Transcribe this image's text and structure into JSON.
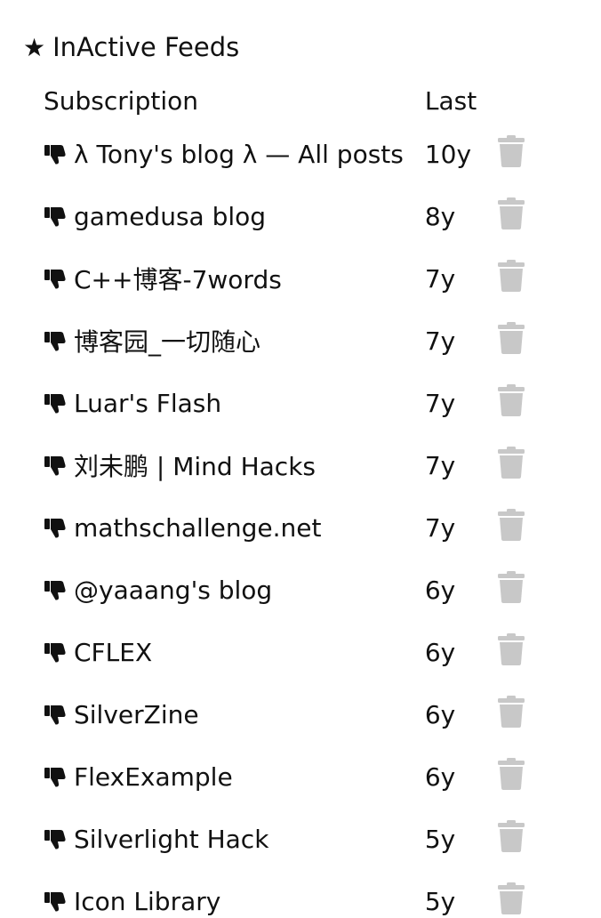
{
  "section": {
    "star": "★",
    "title": "InActive Feeds"
  },
  "columns": {
    "subscription": "Subscription",
    "last": "Last"
  },
  "icons": {
    "row_icon": "thumbs-down-icon",
    "delete_icon": "trash-icon",
    "trash_color": "#c8c8c8"
  },
  "feeds": [
    {
      "name": "λ Tony's blog λ — All posts",
      "last": "10y"
    },
    {
      "name": "gamedusa blog",
      "last": "8y"
    },
    {
      "name": "C++博客-7words",
      "last": "7y"
    },
    {
      "name": "博客园_一切随心",
      "last": "7y"
    },
    {
      "name": "Luar's Flash",
      "last": "7y"
    },
    {
      "name": "刘未鹏 | Mind Hacks",
      "last": "7y"
    },
    {
      "name": "mathschallenge.net",
      "last": "7y"
    },
    {
      "name": "@yaaang's blog",
      "last": "6y"
    },
    {
      "name": "CFLEX",
      "last": "6y"
    },
    {
      "name": "SilverZine",
      "last": "6y"
    },
    {
      "name": "FlexExample",
      "last": "6y"
    },
    {
      "name": "Silverlight Hack",
      "last": "5y"
    },
    {
      "name": "Icon Library",
      "last": "5y"
    }
  ]
}
